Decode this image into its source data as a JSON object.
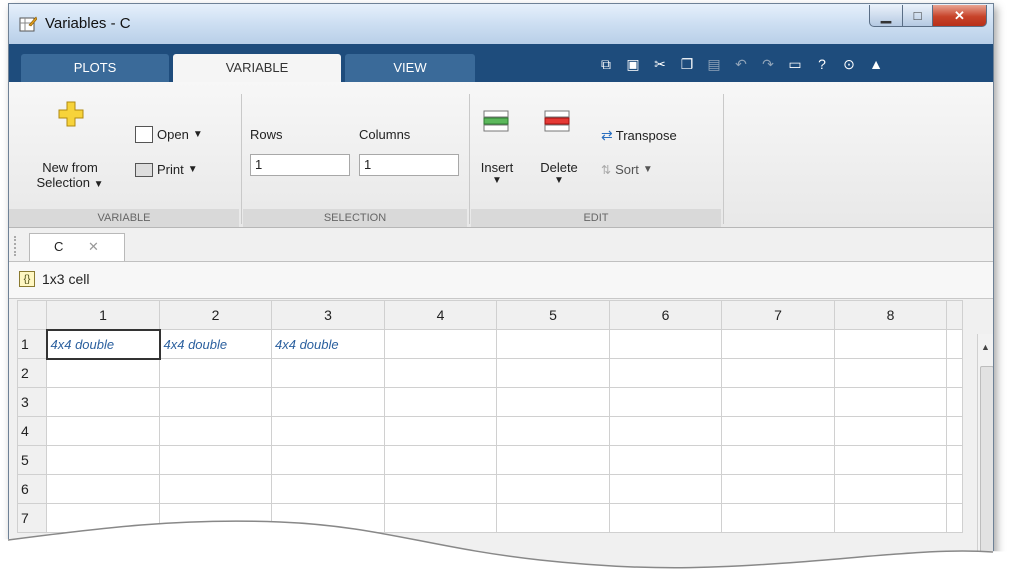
{
  "window": {
    "title": "Variables - C"
  },
  "tabs": [
    "PLOTS",
    "VARIABLE",
    "VIEW"
  ],
  "ribbon": {
    "new_from_line1": "New from",
    "new_from_line2": "Selection",
    "open_label": "Open",
    "print_label": "Print",
    "rows_label": "Rows",
    "columns_label": "Columns",
    "rows_value": "1",
    "columns_value": "1",
    "insert_label": "Insert",
    "delete_label": "Delete",
    "transpose_label": "Transpose",
    "sort_label": "Sort",
    "groups": {
      "variable": "VARIABLE",
      "selection": "SELECTION",
      "edit": "EDIT"
    }
  },
  "doc_tab": {
    "label": "C"
  },
  "info": {
    "icon": "{}",
    "text": "1x3 cell"
  },
  "grid": {
    "columns": [
      "1",
      "2",
      "3",
      "4",
      "5",
      "6",
      "7",
      "8"
    ],
    "rows": [
      "1",
      "2",
      "3",
      "4",
      "5",
      "6",
      "7"
    ],
    "cells_row1": [
      "4x4 double",
      "4x4 double",
      "4x4 double"
    ]
  },
  "colors": {
    "title_bar": "#c9dbf0",
    "tab_strip": "#1e4c7c",
    "cell_text": "#2a5f9e",
    "close_button": "#c7432a"
  }
}
